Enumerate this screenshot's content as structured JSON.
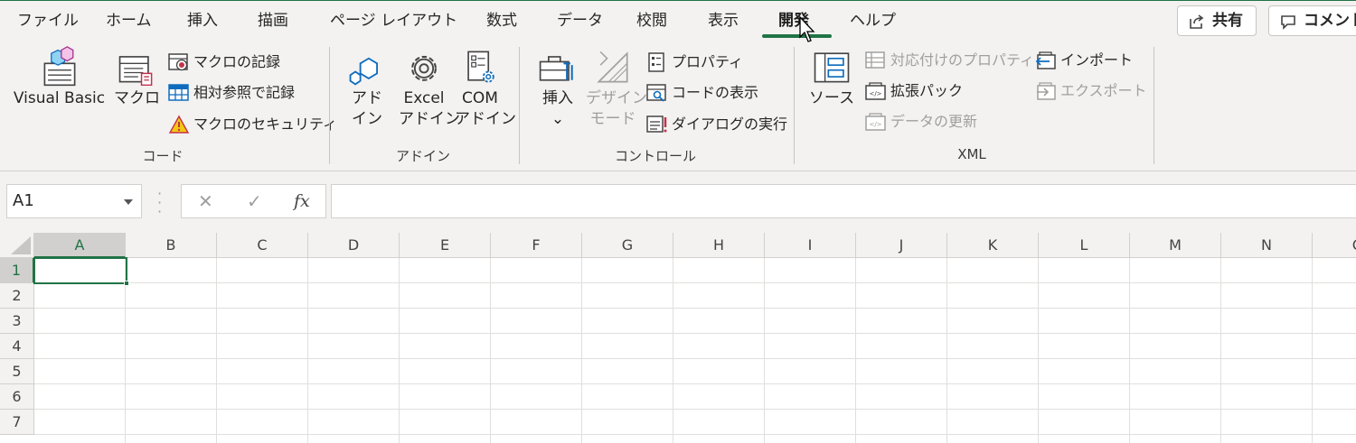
{
  "tabs": [
    {
      "label": "ファイル"
    },
    {
      "label": "ホーム"
    },
    {
      "label": "挿入"
    },
    {
      "label": "描画"
    },
    {
      "label": "ページ レイアウト"
    },
    {
      "label": "数式"
    },
    {
      "label": "データ"
    },
    {
      "label": "校閲"
    },
    {
      "label": "表示"
    },
    {
      "label": "開発"
    },
    {
      "label": "ヘルプ"
    }
  ],
  "active_tab": "開発",
  "share_label": "共有",
  "comment_label": "コメント",
  "groups": {
    "code": {
      "label": "コード",
      "visual_basic": "Visual Basic",
      "macros": "マクロ",
      "record_macro": "マクロの記録",
      "relative_ref": "相対参照で記録",
      "macro_security": "マクロのセキュリティ"
    },
    "addins": {
      "label": "アドイン",
      "addins_line1": "アド",
      "addins_line2": "イン",
      "excel_line1": "Excel",
      "excel_line2": "アドイン",
      "com_line1": "COM",
      "com_line2": "アドイン"
    },
    "controls": {
      "label": "コントロール",
      "insert": "挿入",
      "design_line1": "デザイン",
      "design_line2": "モード",
      "properties": "プロパティ",
      "view_code": "コードの表示",
      "run_dialog": "ダイアログの実行"
    },
    "xml": {
      "label": "XML",
      "source": "ソース",
      "map_properties": "対応付けのプロパティ",
      "expansion_packs": "拡張パック",
      "refresh_data": "データの更新",
      "import": "インポート",
      "export": "エクスポート"
    }
  },
  "formula_bar": {
    "name_box": "A1",
    "cancel": "✕",
    "enter": "✓",
    "fx": "fx",
    "formula": ""
  },
  "grid": {
    "columns": [
      "A",
      "B",
      "C",
      "D",
      "E",
      "F",
      "G",
      "H",
      "I",
      "J",
      "K",
      "L",
      "M",
      "N",
      "O"
    ],
    "rows": [
      "1",
      "2",
      "3",
      "4",
      "5",
      "6",
      "7"
    ],
    "active_cell": "A1"
  },
  "colors": {
    "accent": "#217346",
    "ribbon_bg": "#f3f2f1",
    "warning": "#f2c811"
  }
}
